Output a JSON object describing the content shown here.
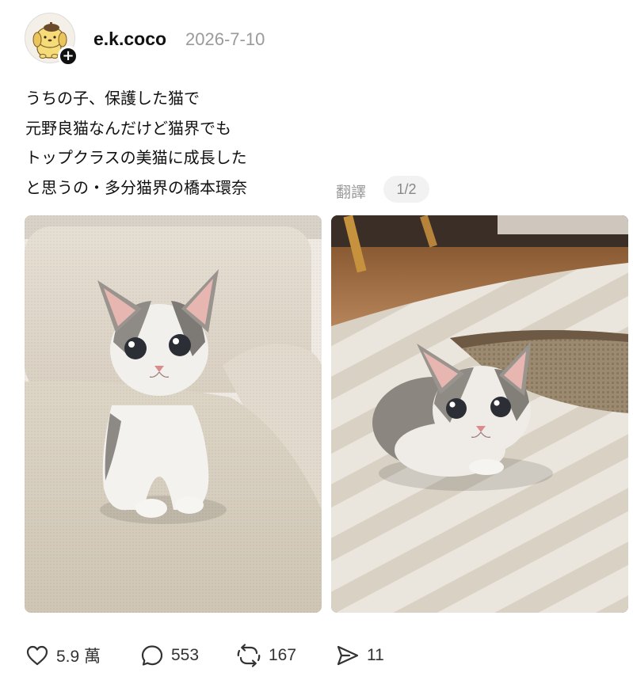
{
  "post": {
    "username": "e.k.coco",
    "date": "2026-7-10",
    "text_lines": [
      "うちの子、保護した猫で",
      "元野良猫なんだけど猫界でも",
      "トップクラスの美猫に成長した",
      "と思うの・多分猫界の橋本環奈"
    ],
    "translate_label": "翻譯",
    "page_indicator": "1/2",
    "follow_badge": "+"
  },
  "actions": {
    "likes": "5.9 萬",
    "comments": "553",
    "reposts": "167",
    "shares": "11"
  },
  "icons": {
    "avatar": "pompompurin-avatar-icon",
    "like": "heart-icon",
    "comment": "speech-bubble-icon",
    "repost": "repost-arrows-icon",
    "share": "send-arrow-icon"
  },
  "colors": {
    "text": "#111111",
    "muted": "#9a9a9a",
    "pill_bg": "#f2f2f2"
  }
}
